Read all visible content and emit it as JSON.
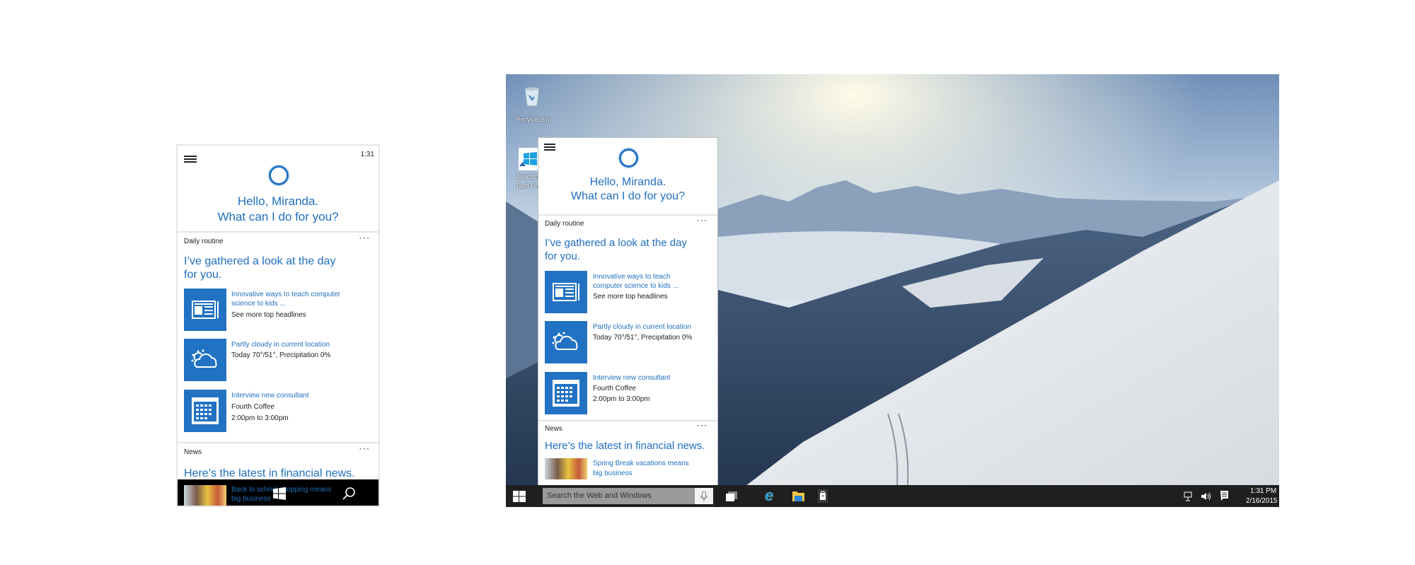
{
  "phone": {
    "time": "1:31",
    "greeting_line1": "Hello, Miranda.",
    "greeting_line2": "What can I do for you?",
    "daily_routine": {
      "label": "Daily routine",
      "more": "···",
      "headline_line1": "I’ve gathered a look at the day",
      "headline_line2": "for you.",
      "items": [
        {
          "icon": "news-icon",
          "title_line1": "Innovative ways to teach computer",
          "title_line2": "science to kids ...",
          "sub1": "See more top headlines"
        },
        {
          "icon": "partly-cloudy-icon",
          "title_line1": "Partly cloudy in current location",
          "sub1": "Today 70°/51°, Precipitation 0%"
        },
        {
          "icon": "calendar-icon",
          "title_line1": "Interview new consultant",
          "sub1": "Fourth Coffee",
          "sub2": "2:00pm to 3:00pm"
        }
      ]
    },
    "news": {
      "label": "News",
      "more": "···",
      "headline": "Here’s the latest in financial news.",
      "item_line1": "Back to school shopping means",
      "item_line2": "big business"
    }
  },
  "desktop": {
    "icons": [
      {
        "label": "Recycle Bin"
      },
      {
        "label_line1": "Welcome",
        "label_line2": "Tech Pre"
      }
    ],
    "cortana": {
      "greeting_line1": "Hello, Miranda.",
      "greeting_line2": "What can I do for you?",
      "daily_routine": {
        "label": "Daily routine",
        "more": "···",
        "headline_line1": "I’ve gathered a look at the day",
        "headline_line2": "for you.",
        "items": [
          {
            "icon": "news-icon",
            "title_line1": "Innovative ways to teach",
            "title_line2": "computer science to kids ...",
            "sub1": "See more top headlines"
          },
          {
            "icon": "partly-cloudy-icon",
            "title_line1": "Partly cloudy in current location",
            "sub1": "Today 70°/51°, Precipitation 0%"
          },
          {
            "icon": "calendar-icon",
            "title_line1": "Interview new consultant",
            "sub1": "Fourth Coffee",
            "sub2": "2:00pm to 3:00pm"
          }
        ]
      },
      "news": {
        "label": "News",
        "more": "···",
        "headline": "Here’s the latest in financial news.",
        "item_line1": "Spring Break vacations means",
        "item_line2": "big business"
      }
    },
    "taskbar": {
      "search_placeholder": "Search the Web and Windows",
      "time": "1:31 PM",
      "date": "2/16/2015"
    }
  },
  "colors": {
    "accent": "#2272c3",
    "text_blue": "#1f6fc0",
    "taskbar": "#1f1f1f"
  }
}
